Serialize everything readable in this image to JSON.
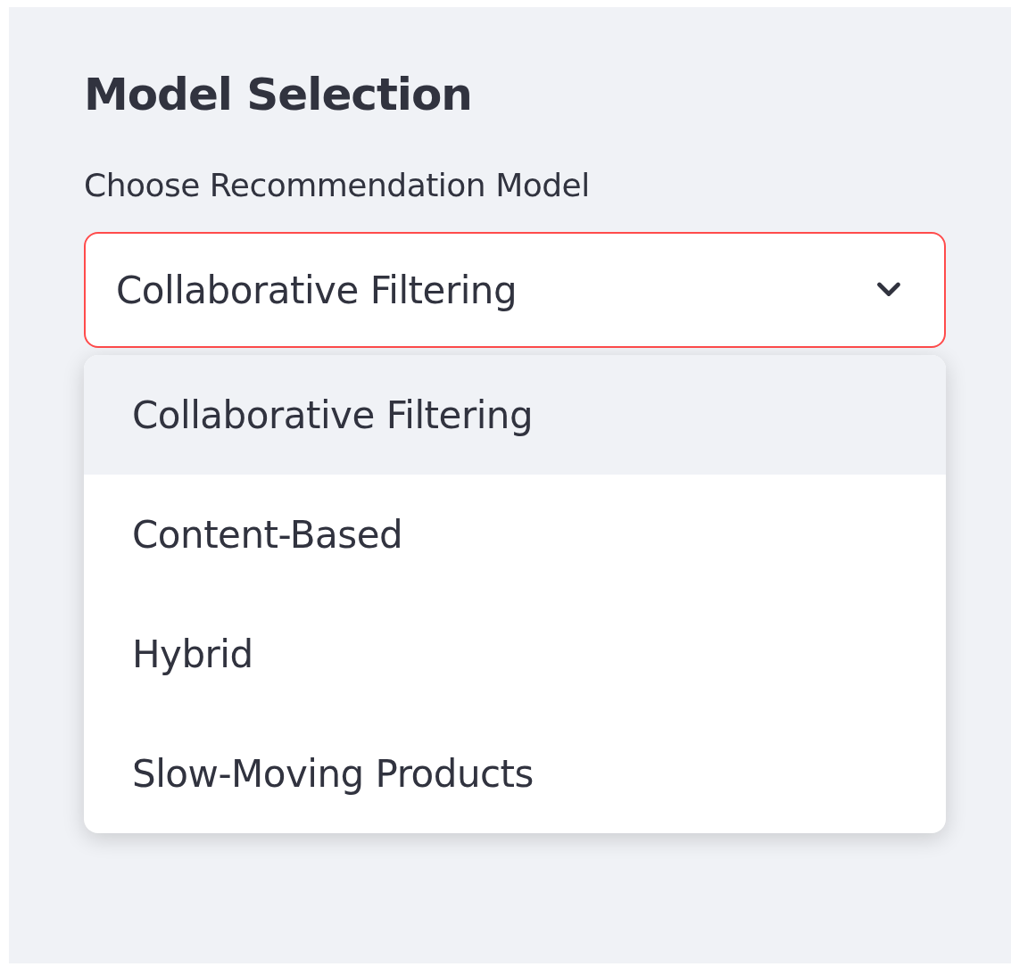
{
  "sidebar": {
    "title": "Model Selection",
    "select": {
      "label": "Choose Recommendation Model",
      "value": "Collaborative Filtering",
      "focused": true,
      "expanded": true,
      "options": [
        {
          "label": "Collaborative Filtering",
          "selected": true
        },
        {
          "label": "Content-Based",
          "selected": false
        },
        {
          "label": "Hybrid",
          "selected": false
        },
        {
          "label": "Slow-Moving Products",
          "selected": false
        }
      ]
    }
  }
}
